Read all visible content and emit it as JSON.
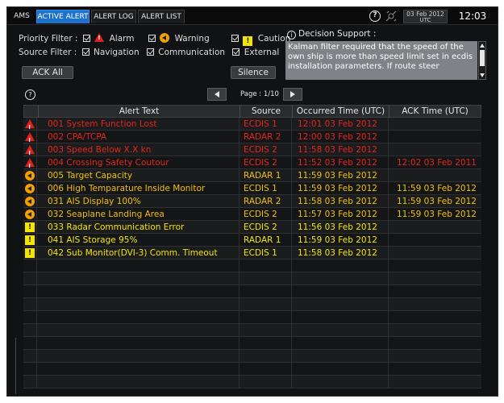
{
  "tabs": [
    {
      "label": "AMS",
      "active": false
    },
    {
      "label": "ACTIVE ALERT",
      "active": true
    },
    {
      "label": "ALERT LOG",
      "active": false
    },
    {
      "label": "ALERT LIST",
      "active": false
    }
  ],
  "status": {
    "date": "03 Feb 2012",
    "timezone": "UTC",
    "time": "12:03"
  },
  "filters": {
    "priority_label": "Priority Filter :",
    "priority_items": [
      "Alarm",
      "Warning",
      "Caution"
    ],
    "source_label": "Source Filter :",
    "source_items": [
      "Navigation",
      "Communication",
      "External"
    ]
  },
  "buttons": {
    "ack_all": "ACK All",
    "silence": "Silence"
  },
  "decision_support": {
    "title": "Decision Support :",
    "text": "Kalman filter required that the speed of the own ship is more than speed limit set in ecdis installation parameters. If route steer"
  },
  "pager": {
    "label": "Page : 1/10"
  },
  "table": {
    "headers": [
      "Alert Text",
      "Source",
      "Occurred Time (UTC)",
      "ACK Time (UTC)"
    ],
    "rows": [
      {
        "priority": "alarm",
        "text": "001  System Function Lost",
        "source": "ECDIS 1",
        "occurred": "12:01  03 Feb 2012",
        "ack": ""
      },
      {
        "priority": "alarm",
        "text": "002  CPA/TCPA",
        "source": "RADAR 2",
        "occurred": "12:00  03 Feb 2012",
        "ack": ""
      },
      {
        "priority": "alarm",
        "text": "003  Speed Below X.X kn",
        "source": "ECDIS 2",
        "occurred": "11:58  03 Feb 2012",
        "ack": ""
      },
      {
        "priority": "alarm",
        "text": "004  Crossing Safety Coutour",
        "source": "ECDIS 2",
        "occurred": "11:52  03 Feb 2012",
        "ack": "12:02  03 Feb 2011"
      },
      {
        "priority": "warning",
        "text": "005  Target Capacity",
        "source": "RADAR 1",
        "occurred": "11:59  03 Feb 2012",
        "ack": ""
      },
      {
        "priority": "warning",
        "text": "006  High Temparature Inside Monitor",
        "source": "ECDIS 1",
        "occurred": "11:59  03 Feb 2012",
        "ack": "11:59  03 Feb 2012"
      },
      {
        "priority": "warning",
        "text": "031  AIS Display 100%",
        "source": "RADAR 2",
        "occurred": "11:58  03 Feb 2012",
        "ack": "11:59  03 Feb 2012"
      },
      {
        "priority": "warning",
        "text": "032  Seaplane Landing Area",
        "source": "ECDIS 2",
        "occurred": "11:57  03 Feb 2012",
        "ack": "11:59  03 Feb 2012"
      },
      {
        "priority": "caution",
        "text": "033  Radar Communication Error",
        "source": "ECDIS 2",
        "occurred": "11:56  03 Feb 2012",
        "ack": ""
      },
      {
        "priority": "caution",
        "text": "041  AIS Storage 95%",
        "source": "RADAR 1",
        "occurred": "11:59  03 Feb 2012",
        "ack": ""
      },
      {
        "priority": "caution",
        "text": "042  Sub Monitor(DVI-3) Comm. Timeout",
        "source": "ECDIS 1",
        "occurred": "11:58  03 Feb 2012",
        "ack": ""
      }
    ],
    "empty_rows": 10
  },
  "colors": {
    "alarm": "#e8231c",
    "warning": "#f2c000",
    "caution": "#f2e600",
    "active_tab": "#1d72d0"
  }
}
